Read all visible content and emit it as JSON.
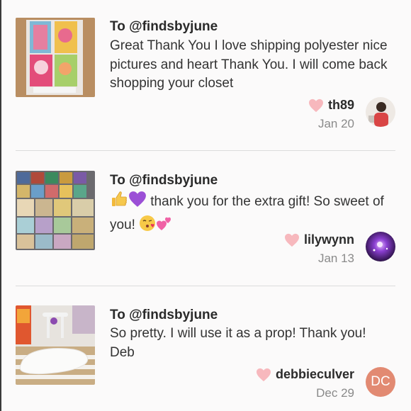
{
  "reviews": [
    {
      "to": "To @findsbyjune",
      "message": "Great Thank You I love shipping polyester nice pictures and heart Thank You. I will come back shopping your closet",
      "username": "th89",
      "date": "Jan 20"
    },
    {
      "to": "To @findsbyjune",
      "message_text_1": "thank you for the extra gift! So sweet of you!",
      "username": "lilywynn",
      "date": "Jan 13"
    },
    {
      "to": "To @findsbyjune",
      "message": "So pretty. I will use it as a prop! Thank you! Deb",
      "username": "debbieculver",
      "date": "Dec 29",
      "avatar_initials": "DC"
    }
  ],
  "colors": {
    "heart": "#f7b8bd",
    "dc_avatar": "#e28a72",
    "divider": "#dcdcdc",
    "date_text": "#8a8a8a"
  },
  "icons": [
    "heart-icon",
    "thumbs-up-emoji",
    "purple-heart-emoji",
    "kissing-face-emoji",
    "two-hearts-emoji"
  ]
}
